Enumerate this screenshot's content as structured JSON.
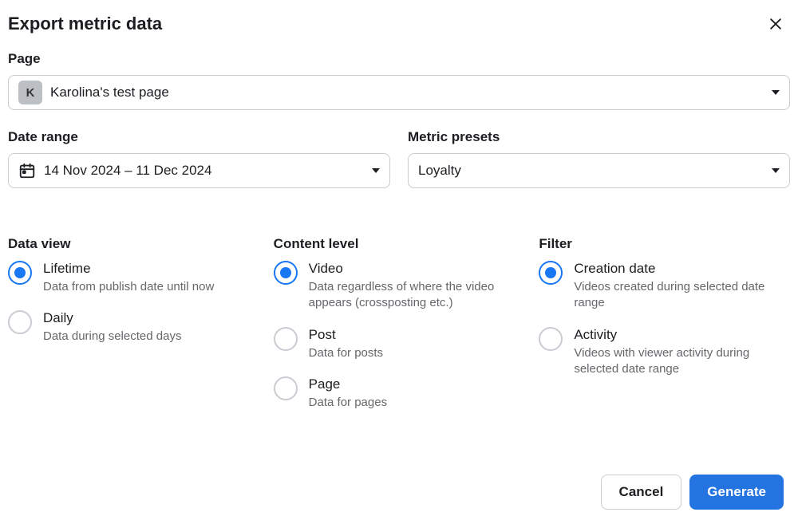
{
  "header": {
    "title": "Export metric data"
  },
  "page_field": {
    "label": "Page",
    "avatar_letter": "K",
    "value": "Karolina's test page"
  },
  "date_range_field": {
    "label": "Date range",
    "value": "14 Nov 2024 – 11 Dec 2024"
  },
  "metric_presets_field": {
    "label": "Metric presets",
    "value": "Loyalty"
  },
  "data_view": {
    "label": "Data view",
    "options": [
      {
        "label": "Lifetime",
        "desc": "Data from publish date until now",
        "selected": true
      },
      {
        "label": "Daily",
        "desc": "Data during selected days",
        "selected": false
      }
    ]
  },
  "content_level": {
    "label": "Content level",
    "options": [
      {
        "label": "Video",
        "desc": "Data regardless of where the video appears (crossposting etc.)",
        "selected": true
      },
      {
        "label": "Post",
        "desc": "Data for posts",
        "selected": false
      },
      {
        "label": "Page",
        "desc": "Data for pages",
        "selected": false
      }
    ]
  },
  "filter": {
    "label": "Filter",
    "options": [
      {
        "label": "Creation date",
        "desc": "Videos created during selected date range",
        "selected": true
      },
      {
        "label": "Activity",
        "desc": "Videos with viewer activity during selected date range",
        "selected": false
      }
    ]
  },
  "footer": {
    "cancel_label": "Cancel",
    "generate_label": "Generate"
  }
}
